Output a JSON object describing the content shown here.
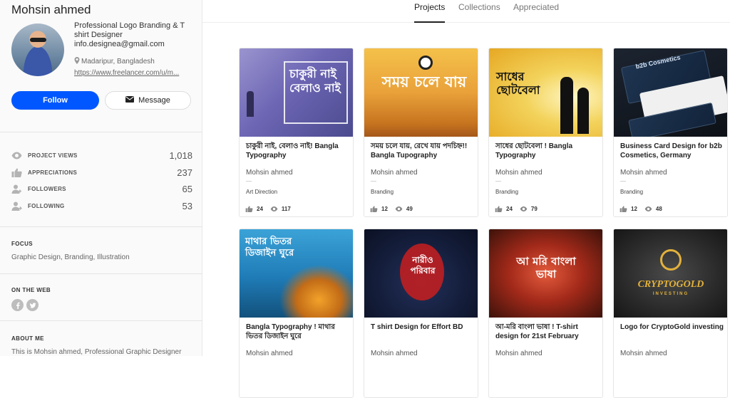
{
  "profile": {
    "name": "Mohsin ahmed",
    "bio": "Professional Logo Branding & T shirt Designer",
    "email": "info.designea@gmail.com",
    "location": "Madaripur, Bangladesh",
    "link": "https://www.freelancer.com/u/m...",
    "follow_label": "Follow",
    "message_label": "Message"
  },
  "stats": [
    {
      "label": "PROJECT VIEWS",
      "value": "1,018",
      "icon": "eye-icon"
    },
    {
      "label": "APPRECIATIONS",
      "value": "237",
      "icon": "thumbs-up-icon"
    },
    {
      "label": "FOLLOWERS",
      "value": "65",
      "icon": "followers-icon"
    },
    {
      "label": "FOLLOWING",
      "value": "53",
      "icon": "following-icon"
    }
  ],
  "focus": {
    "heading": "FOCUS",
    "text": "Graphic Design, Branding, Illustration"
  },
  "web": {
    "heading": "ON THE WEB"
  },
  "about": {
    "heading": "ABOUT ME",
    "text": "This is Mohsin ahmed, Professional Graphic Designer"
  },
  "tabs": [
    {
      "label": "Projects",
      "active": true
    },
    {
      "label": "Collections",
      "active": false
    },
    {
      "label": "Appreciated",
      "active": false
    }
  ],
  "projects": [
    {
      "title": "চাকুরী নাই, বেলাও নাই! Bangla Typography",
      "owner": "Mohsin ahmed",
      "dash": "—",
      "tag": "Art Direction",
      "likes": "24",
      "views": "117",
      "thumb_text": "চাকুরী নাই বেলাও নাই"
    },
    {
      "title": "সময় চলে যায়, রেখে যায় পদচিহ্ন!! Bangla Tupography",
      "owner": "Mohsin ahmed",
      "dash": "—",
      "tag": "Branding",
      "likes": "12",
      "views": "49",
      "thumb_text": "সময় চলে যায়"
    },
    {
      "title": "সাধের ছোটবেলা ! Bangla Typography",
      "owner": "Mohsin ahmed",
      "dash": "—",
      "tag": "Branding",
      "likes": "24",
      "views": "79",
      "thumb_text": "সাধের ছোটবেলা"
    },
    {
      "title": "Business Card Design for b2b Cosmetics, Germany",
      "owner": "Mohsin ahmed",
      "dash": "—",
      "tag": "Branding",
      "likes": "12",
      "views": "48",
      "thumb_text": "b2b Cosmetics"
    },
    {
      "title": "Bangla Typography ! মাথার ভিতর ডিজাইন ঘুরে",
      "owner": "Mohsin ahmed",
      "thumb_text": "মাথার ভিতর ডিজাইন ঘুরে"
    },
    {
      "title": "T shirt Design for Effort BD",
      "owner": "Mohsin ahmed",
      "thumb_text": "নারীও পরিবার"
    },
    {
      "title": "আ-মরি বাংলা ভাষা ! T-shirt design for 21st February",
      "owner": "Mohsin ahmed",
      "thumb_text": "আ মরি বাংলা ভাষা"
    },
    {
      "title": "Logo for CryptoGold investing",
      "owner": "Mohsin ahmed",
      "thumb_text": "CRYPTOGOLD",
      "thumb_sub": "INVESTING"
    }
  ],
  "colors": {
    "accent": "#0057ff"
  }
}
